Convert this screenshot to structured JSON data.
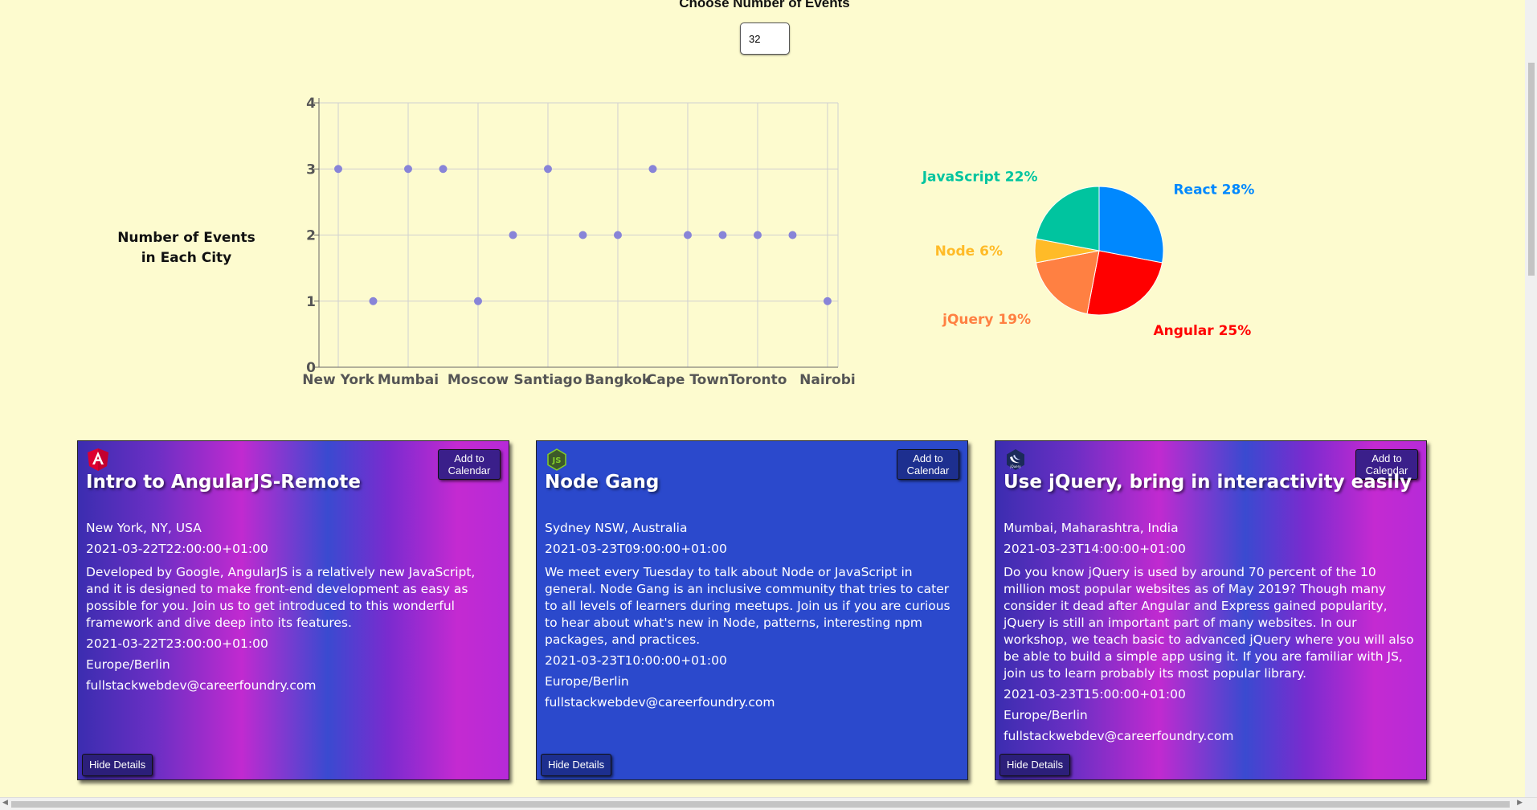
{
  "header": {
    "title": "Choose Number of Events",
    "number_of_events": "32"
  },
  "scatter": {
    "label": "Number of Events in Each City"
  },
  "chart_data": [
    {
      "type": "scatter",
      "title": "",
      "xlabel": "",
      "ylabel": "",
      "ylim": [
        0,
        4
      ],
      "grid": true,
      "x_ticks": [
        "New York",
        "Mumbai",
        "Moscow",
        "Santiago",
        "Bangkok",
        "Cape Town",
        "Toronto",
        "Nairobi"
      ],
      "y_ticks": [
        "0",
        "1",
        "2",
        "3",
        "4"
      ],
      "points": [
        {
          "x": 0,
          "y": 3
        },
        {
          "x": 1,
          "y": 1
        },
        {
          "x": 2,
          "y": 3
        },
        {
          "x": 3,
          "y": 3
        },
        {
          "x": 4,
          "y": 1
        },
        {
          "x": 5,
          "y": 2
        },
        {
          "x": 6,
          "y": 3
        },
        {
          "x": 7,
          "y": 2
        },
        {
          "x": 8,
          "y": 2
        },
        {
          "x": 9,
          "y": 3
        },
        {
          "x": 10,
          "y": 2
        },
        {
          "x": 11,
          "y": 2
        },
        {
          "x": 12,
          "y": 2
        },
        {
          "x": 13,
          "y": 2
        },
        {
          "x": 14,
          "y": 1
        }
      ],
      "x_tick_positions": [
        0,
        2,
        4,
        6,
        8,
        10,
        12,
        14
      ],
      "x_range": [
        0,
        14.3
      ],
      "point_color": "#8884d8"
    },
    {
      "type": "pie",
      "slices": [
        {
          "label": "React 28%",
          "value": 28,
          "color": "#0088fe"
        },
        {
          "label": "Angular 25%",
          "value": 25,
          "color": "#ff0000"
        },
        {
          "label": "jQuery 19%",
          "value": 19,
          "color": "#ff8042"
        },
        {
          "label": "Node 6%",
          "value": 6,
          "color": "#ffbb28"
        },
        {
          "label": "JavaScript 22%",
          "value": 22,
          "color": "#00c49f"
        }
      ]
    }
  ],
  "events": [
    {
      "logo": "angular-icon",
      "calendar_label": "Add to Calendar",
      "title": "Intro to AngularJS-Remote",
      "location": "New York, NY, USA",
      "start": "2021-03-22T22:00:00+01:00",
      "description": "Developed by Google, AngularJS is a relatively new JavaScript, and it is designed to make front-end development as easy as possible for you. Join us to get introduced to this wonderful framework and dive deep into its features.",
      "end": "2021-03-22T23:00:00+01:00",
      "timezone": "Europe/Berlin",
      "email": "fullstackwebdev@careerfoundry.com",
      "hide_label": "Hide Details"
    },
    {
      "logo": "nodejs-icon",
      "calendar_label": "Add to Calendar",
      "title": "Node Gang",
      "location": "Sydney NSW, Australia",
      "start": "2021-03-23T09:00:00+01:00",
      "description": "We meet every Tuesday to talk about Node or JavaScript in general. Node Gang is an inclusive community that tries to cater to all levels of learners during meetups. Join us if you are curious to hear about what's new in Node, patterns, interesting npm packages, and practices.",
      "end": "2021-03-23T10:00:00+01:00",
      "timezone": "Europe/Berlin",
      "email": "fullstackwebdev@careerfoundry.com",
      "hide_label": "Hide Details"
    },
    {
      "logo": "jquery-icon",
      "calendar_label": "Add to Calendar",
      "title": "Use jQuery, bring in interactivity easily",
      "location": "Mumbai, Maharashtra, India",
      "start": "2021-03-23T14:00:00+01:00",
      "description": "Do you know jQuery is used by around 70 percent of the 10 million most popular websites as of May 2019? Though many consider it dead after Angular and Express gained popularity, jQuery is still an important part of many websites. In our workshop, we teach basic to advanced jQuery where you will also be able to build a simple app using it. If you are familiar with JS, join us to learn probably its most popular library.",
      "end": "2021-03-23T15:00:00+01:00",
      "timezone": "Europe/Berlin",
      "email": "fullstackwebdev@careerfoundry.com",
      "hide_label": "Hide Details"
    }
  ]
}
